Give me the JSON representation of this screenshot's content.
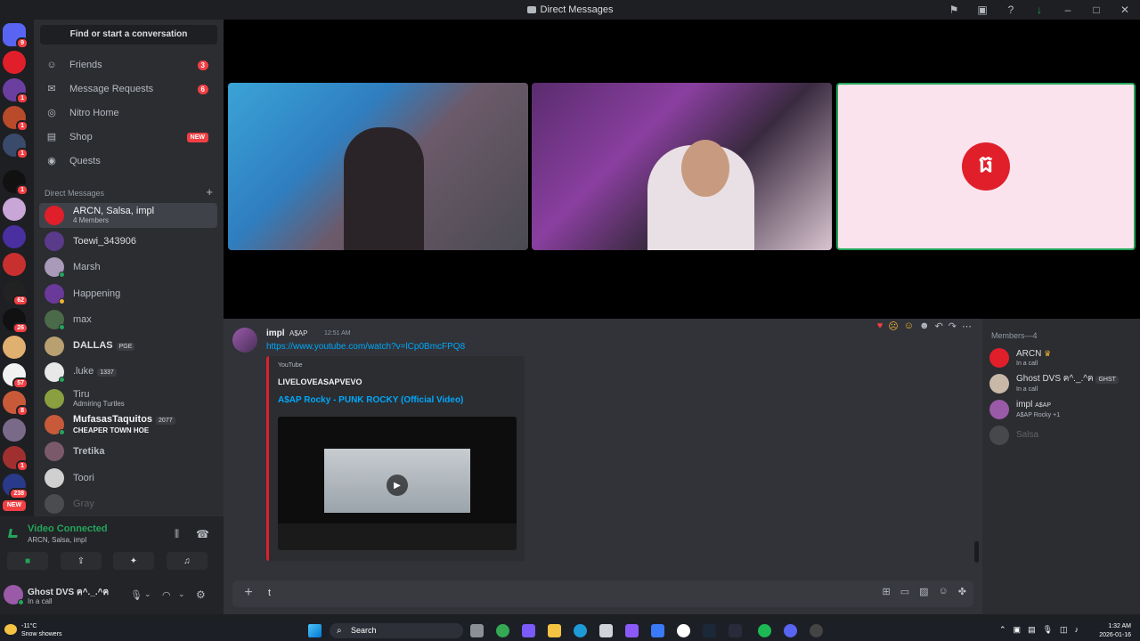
{
  "window": {
    "title": "Direct Messages"
  },
  "sidebar": {
    "search_label": "Find or start a conversation",
    "nav": [
      {
        "label": "Friends",
        "badge": "3"
      },
      {
        "label": "Message Requests",
        "badge": "6"
      },
      {
        "label": "Nitro Home",
        "badge": ""
      },
      {
        "label": "Shop",
        "badge": "NEW"
      },
      {
        "label": "Quests",
        "badge": ""
      }
    ],
    "dm_header": "Direct Messages",
    "dms": [
      {
        "name": "ARCN, Salsa, impl",
        "sub": "4 Members",
        "tag": ""
      },
      {
        "name": "Toewi_343906",
        "sub": "",
        "tag": ""
      },
      {
        "name": "Marsh",
        "sub": "",
        "tag": ""
      },
      {
        "name": "Happening",
        "sub": "",
        "tag": ""
      },
      {
        "name": "max",
        "sub": "",
        "tag": ""
      },
      {
        "name": "DALLAS",
        "sub": "",
        "tag": "PGE"
      },
      {
        "name": ".luke",
        "sub": "",
        "tag": "1337"
      },
      {
        "name": "Tiru",
        "sub": "Admiring Turtles",
        "tag": ""
      },
      {
        "name": "MufasasTaquitos",
        "sub": "CHEAPER TOWN HOE",
        "tag": "2077"
      },
      {
        "name": "Tretika",
        "sub": "",
        "tag": ""
      },
      {
        "name": "Toori",
        "sub": "",
        "tag": ""
      },
      {
        "name": "Gray",
        "sub": "",
        "tag": ""
      }
    ]
  },
  "guild_badges": [
    "9",
    "1",
    "1",
    "1",
    "1",
    "62",
    "26",
    "57",
    "8",
    "1",
    "238",
    "NEW"
  ],
  "voice": {
    "title": "Video Connected",
    "sub": "ARCN, Salsa, impl"
  },
  "user": {
    "name": "Ghost DVS ฅ^._.^ฅ",
    "status": "In a call"
  },
  "message": {
    "author": "impl",
    "tag": "A$AP",
    "time": "12:51 AM",
    "link": "https://www.youtube.com/watch?v=lCp0BmcFPQ8",
    "embed": {
      "provider": "YouTube",
      "author": "LIVELOVEASAPVEVO",
      "title": "A$AP Rocky - PUNK ROCKY (Official Video)"
    }
  },
  "composer": {
    "text": "t"
  },
  "members": {
    "header": "Members—4",
    "list": [
      {
        "name": "ARCN",
        "status": "In a call",
        "tag": ""
      },
      {
        "name": "Ghost DVS ฅ^._.^ฅ",
        "status": "In a call",
        "tag": "GHST"
      },
      {
        "name": "impl",
        "status": "A$AP Rocky +1",
        "tag": "A$AP"
      },
      {
        "name": "Salsa",
        "status": "",
        "tag": ""
      }
    ]
  },
  "taskbar": {
    "temp": "-11°C",
    "weather": "Snow showers",
    "search": "Search",
    "time": "1:32 AM",
    "date": "2026-01-16"
  },
  "colors": {
    "accent": "#5865f2",
    "danger": "#f23f43",
    "online": "#23a55a",
    "link": "#00a8fc"
  }
}
